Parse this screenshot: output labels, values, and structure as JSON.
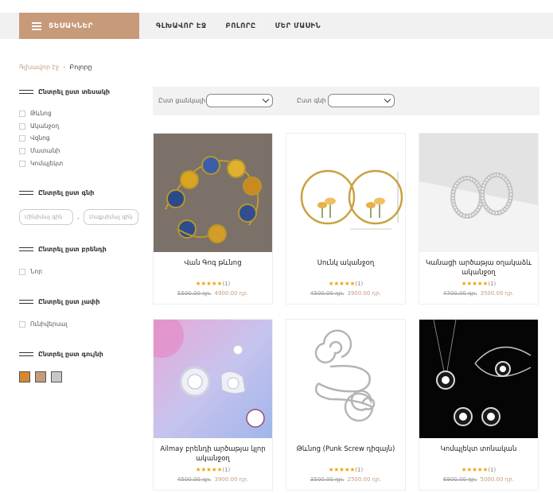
{
  "header": {
    "categories_label": "ՏԵՍԱԿՆԵՐ",
    "nav": [
      "ԳԼԽԱՎՈՐ ԷՋ",
      "ԲՈԼՈՐԸ",
      "ՄԵՐ ՄԱՍԻՆ"
    ]
  },
  "breadcrumb": {
    "home": "Գլխավոր էջ",
    "separator": "›",
    "current": "Բոլորը"
  },
  "filters": {
    "by_type_title": "Ընտրել ըստ տեսակի",
    "types": [
      "Թևնոց",
      "Ականջօղ",
      "Վզնոց",
      "Մատանի",
      "Կոմպլեկտ"
    ],
    "by_price_title": "Ընտրել ըստ գնի",
    "price_min_placeholder": "Մինիմալ գին",
    "price_separator": "-",
    "price_max_placeholder": "Մաքսիմալ գին",
    "by_brand_title": "Ընտրել ըստ բրենդի",
    "brands": [
      "Նոր"
    ],
    "by_size_title": "Ընտրել ըստ չափի",
    "sizes": [
      "Ունիվերսալ"
    ],
    "by_color_title": "Ընտրել ըստ գույնի",
    "colors": [
      "#d4892e",
      "#c79a7a",
      "#c8c8c8"
    ]
  },
  "sortbar": {
    "by_sort_label": "Ըստ ցանկալի",
    "by_price_label": "Ըստ գնի"
  },
  "products": [
    {
      "name": "Վան Գոգ թևնոց",
      "rating_count": "(1)",
      "old_price": "5500.00 դր․",
      "price": "4900.00 դր․"
    },
    {
      "name": "Սունկ ականջօղ",
      "rating_count": "(1)",
      "old_price": "4500.00 դր․",
      "price": "3900.00 դր․"
    },
    {
      "name": "Կանացի արծաթյա օղակաձև ականջօղ",
      "rating_count": "(1)",
      "old_price": "4700.00 դր․",
      "price": "3500.00 դր․"
    },
    {
      "name": "Ailmay բրենդի արծաթյա կլոր ականջօղ",
      "rating_count": "(1)",
      "old_price": "4500.00 դր․",
      "price": "3900.00 դր․"
    },
    {
      "name": "Թևնոց (Punk Screw դիզայն)",
      "rating_count": "(1)",
      "old_price": "3500.00 դր․",
      "price": "2500.00 դր․"
    },
    {
      "name": "Կոմպլեկտ տոնական",
      "rating_count": "(1)",
      "old_price": "6900.00 դր․",
      "price": "5000.00 դր․"
    }
  ],
  "stars": "★★★★★"
}
